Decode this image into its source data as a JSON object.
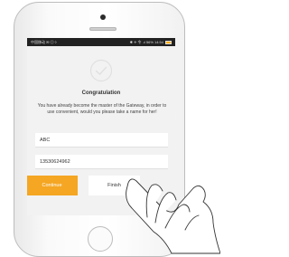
{
  "status_bar": {
    "left": "中国移动 ✉ ◎ ◊",
    "right": "✱ ✈ 令 .ıl 56%  14:54"
  },
  "dialog": {
    "title": "Congratulation",
    "message": "You have already become the master of the Gateway, in order to use convenient, would you please take a name for her!",
    "name_value": "ABC",
    "phone_value": "13530624962",
    "continue_label": "Continue",
    "finish_label": "Finish"
  },
  "colors": {
    "accent": "#f5a623",
    "screen_background": "#f2f2f2"
  },
  "icons": [
    "check-circle-icon",
    "hand-pointer-icon",
    "battery-icon"
  ]
}
